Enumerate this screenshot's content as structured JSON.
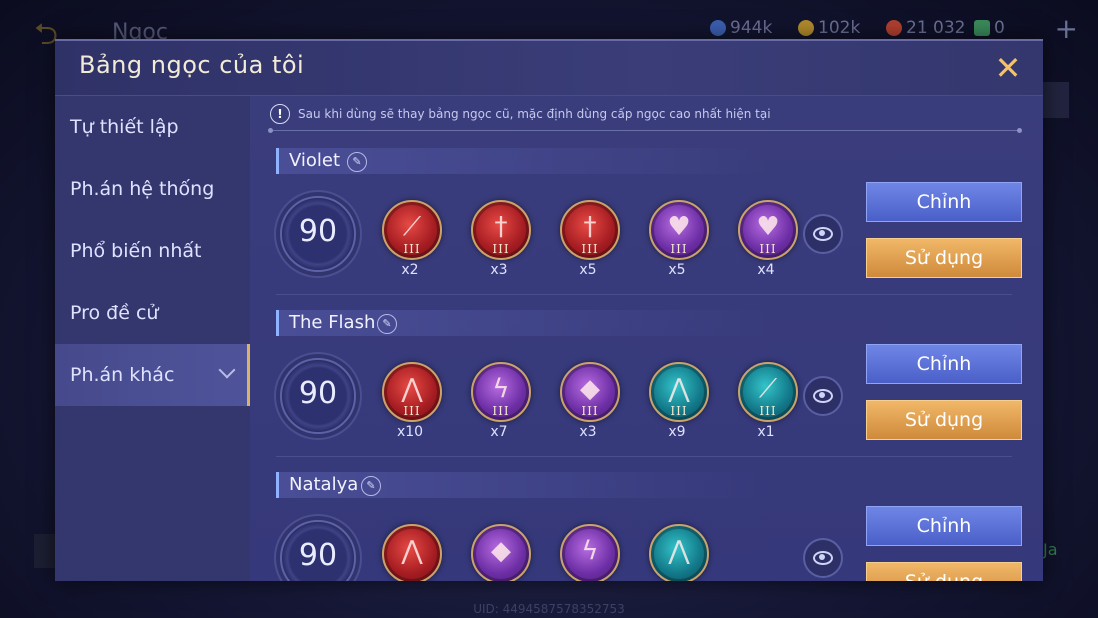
{
  "background": {
    "title": "Ngọc",
    "currencies": [
      {
        "icon": "blue-orb-icon",
        "color": "#3b5fb0",
        "value": "944k"
      },
      {
        "icon": "gold-coin-icon",
        "color": "#b08a2c",
        "value": "102k"
      },
      {
        "icon": "red-gem-icon",
        "color": "#b04030",
        "value": "21 032"
      },
      {
        "icon": "green-voucher-icon",
        "color": "#3a8a5a",
        "value": "0"
      }
    ],
    "uid": "UID: 4494587578352753",
    "right_text": "Ja"
  },
  "modal": {
    "title": "Bảng ngọc của tôi",
    "notice": "Sau khi dùng sẽ thay bảng ngọc cũ, mặc định dùng cấp ngọc cao nhất hiện tại"
  },
  "sidebar": {
    "items": [
      {
        "label": "Tự thiết lập"
      },
      {
        "label": "Ph.án hệ thống"
      },
      {
        "label": "Phổ biến nhất"
      },
      {
        "label": "Pro đề cử"
      },
      {
        "label": "Ph.án khác"
      }
    ],
    "active_index": 4
  },
  "buttons": {
    "edit": "Chỉnh",
    "use": "Sử dụng"
  },
  "rune_sets": [
    {
      "name": "Violet",
      "level": "90",
      "runes": [
        {
          "color": "red",
          "icon": "blade-icon",
          "tier": "III",
          "count": "x2"
        },
        {
          "color": "red",
          "icon": "sword-icon",
          "tier": "III",
          "count": "x3"
        },
        {
          "color": "red",
          "icon": "sword-icon",
          "tier": "III",
          "count": "x5"
        },
        {
          "color": "purple",
          "icon": "heart-icon",
          "tier": "III",
          "count": "x5"
        },
        {
          "color": "purple",
          "icon": "heart-icon",
          "tier": "III",
          "count": "x4"
        }
      ]
    },
    {
      "name": "The Flash",
      "level": "90",
      "runes": [
        {
          "color": "red",
          "icon": "claw-icon",
          "tier": "III",
          "count": "x10"
        },
        {
          "color": "purple",
          "icon": "lightning-icon",
          "tier": "III",
          "count": "x7"
        },
        {
          "color": "purple",
          "icon": "drop-icon",
          "tier": "III",
          "count": "x3"
        },
        {
          "color": "teal",
          "icon": "claw-icon",
          "tier": "III",
          "count": "x9"
        },
        {
          "color": "teal",
          "icon": "blade-icon",
          "tier": "III",
          "count": "x1"
        }
      ]
    },
    {
      "name": "Natalya",
      "level": "90",
      "runes": [
        {
          "color": "red",
          "icon": "claw-icon",
          "tier": "",
          "count": ""
        },
        {
          "color": "purple",
          "icon": "drop-icon",
          "tier": "",
          "count": ""
        },
        {
          "color": "purple",
          "icon": "lightning-icon",
          "tier": "",
          "count": ""
        },
        {
          "color": "teal",
          "icon": "claw-icon",
          "tier": "",
          "count": ""
        }
      ]
    }
  ]
}
